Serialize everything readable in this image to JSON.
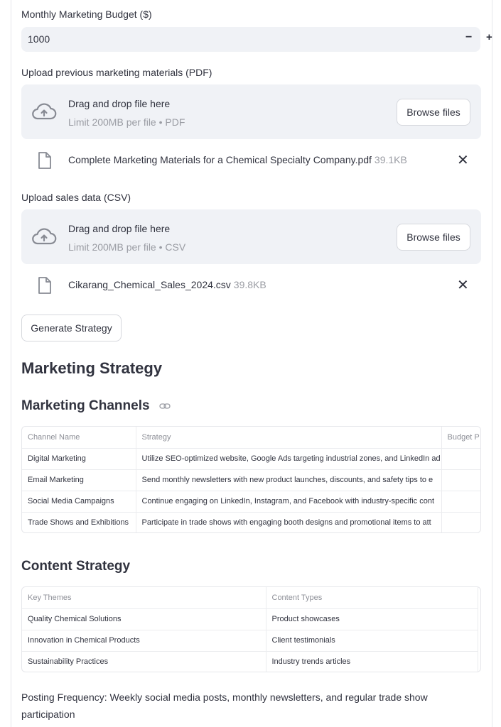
{
  "budget": {
    "label": "Monthly Marketing Budget ($)",
    "value": "1000",
    "minus": "−",
    "plus": "+"
  },
  "upload_pdf": {
    "label": "Upload previous marketing materials (PDF)",
    "drop_title": "Drag and drop file here",
    "drop_limit": "Limit 200MB per file • PDF",
    "browse_label": "Browse files",
    "file": {
      "name": "Complete Marketing Materials for a Chemical Specialty Company.pdf",
      "size": "39.1KB"
    }
  },
  "upload_csv": {
    "label": "Upload sales data (CSV)",
    "drop_title": "Drag and drop file here",
    "drop_limit": "Limit 200MB per file • CSV",
    "browse_label": "Browse files",
    "file": {
      "name": "Cikarang_Chemical_Sales_2024.csv",
      "size": "39.8KB"
    }
  },
  "generate_label": "Generate Strategy",
  "strategy_title": "Marketing Strategy",
  "channels": {
    "title": "Marketing Channels",
    "columns": [
      "Channel Name",
      "Strategy",
      "Budget P"
    ],
    "rows": [
      [
        "Digital Marketing",
        "Utilize SEO-optimized website, Google Ads targeting industrial zones, and LinkedIn ad",
        ""
      ],
      [
        "Email Marketing",
        "Send monthly newsletters with new product launches, discounts, and safety tips to e",
        ""
      ],
      [
        "Social Media Campaigns",
        "Continue engaging on LinkedIn, Instagram, and Facebook with industry-specific cont",
        ""
      ],
      [
        "Trade Shows and Exhibitions",
        "Participate in trade shows with engaging booth designs and promotional items to att",
        ""
      ]
    ]
  },
  "content": {
    "title": "Content Strategy",
    "columns": [
      "Key Themes",
      "Content Types"
    ],
    "rows": [
      [
        "Quality Chemical Solutions",
        "Product showcases"
      ],
      [
        "Innovation in Chemical Products",
        "Client testimonials"
      ],
      [
        "Sustainability Practices",
        "Industry trends articles"
      ]
    ]
  },
  "posting_frequency": "Posting Frequency: Weekly social media posts, monthly newsletters, and regular trade show participation",
  "colors": {
    "input_bg": "#f0f2f6",
    "text": "#31333f",
    "muted": "#9a9ca3",
    "border": "#e6e7eb"
  },
  "icons": {
    "upload": "cloud-upload-icon",
    "file": "file-icon",
    "close": "close-icon",
    "link": "link-icon"
  }
}
